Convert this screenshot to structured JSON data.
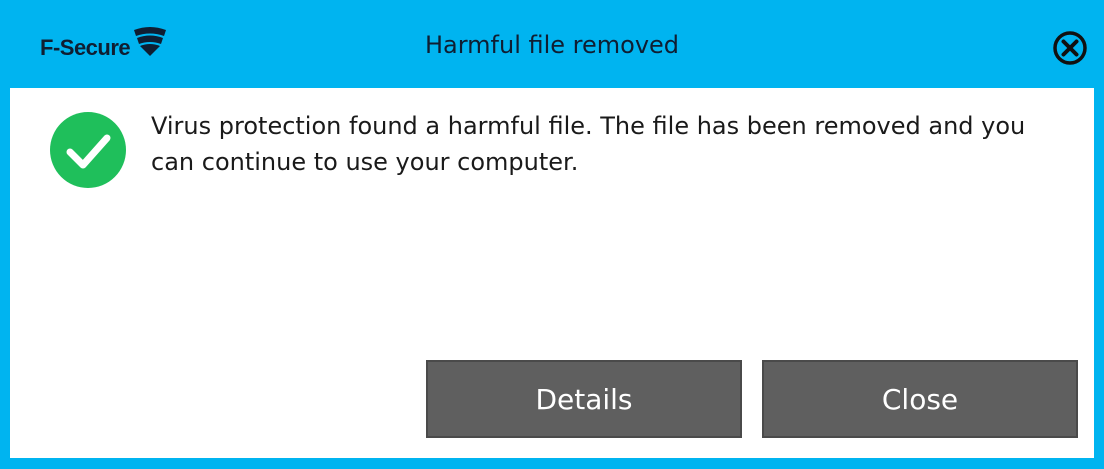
{
  "window": {
    "brand": "F-Secure",
    "title": "Harmful file removed",
    "accent_color": "#00b4f0",
    "close_icon": "close-circle-icon"
  },
  "notification": {
    "status_icon": "check-circle-icon",
    "status_color": "#1fbf5b",
    "message": "Virus protection found a harmful file. The file has been removed and you can continue to use your computer."
  },
  "buttons": {
    "details_label": "Details",
    "close_label": "Close"
  }
}
